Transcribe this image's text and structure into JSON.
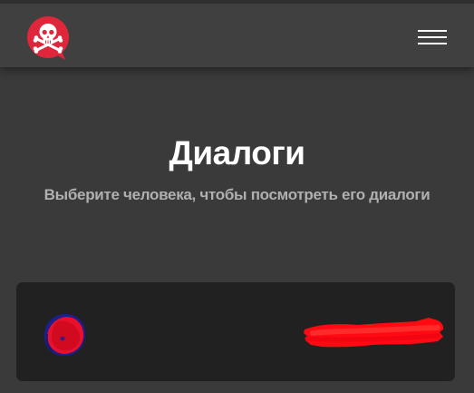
{
  "header": {
    "logo_icon": "skull-crossbones-chat-icon",
    "menu_icon": "hamburger-menu-icon",
    "accent_color": "#e0263a"
  },
  "main": {
    "title": "Диалоги",
    "subtitle": "Выберите человека, чтобы посмотреть его диалоги"
  },
  "dialogs": [
    {
      "avatar_icon": "redacted-avatar-icon",
      "name": ""
    }
  ]
}
